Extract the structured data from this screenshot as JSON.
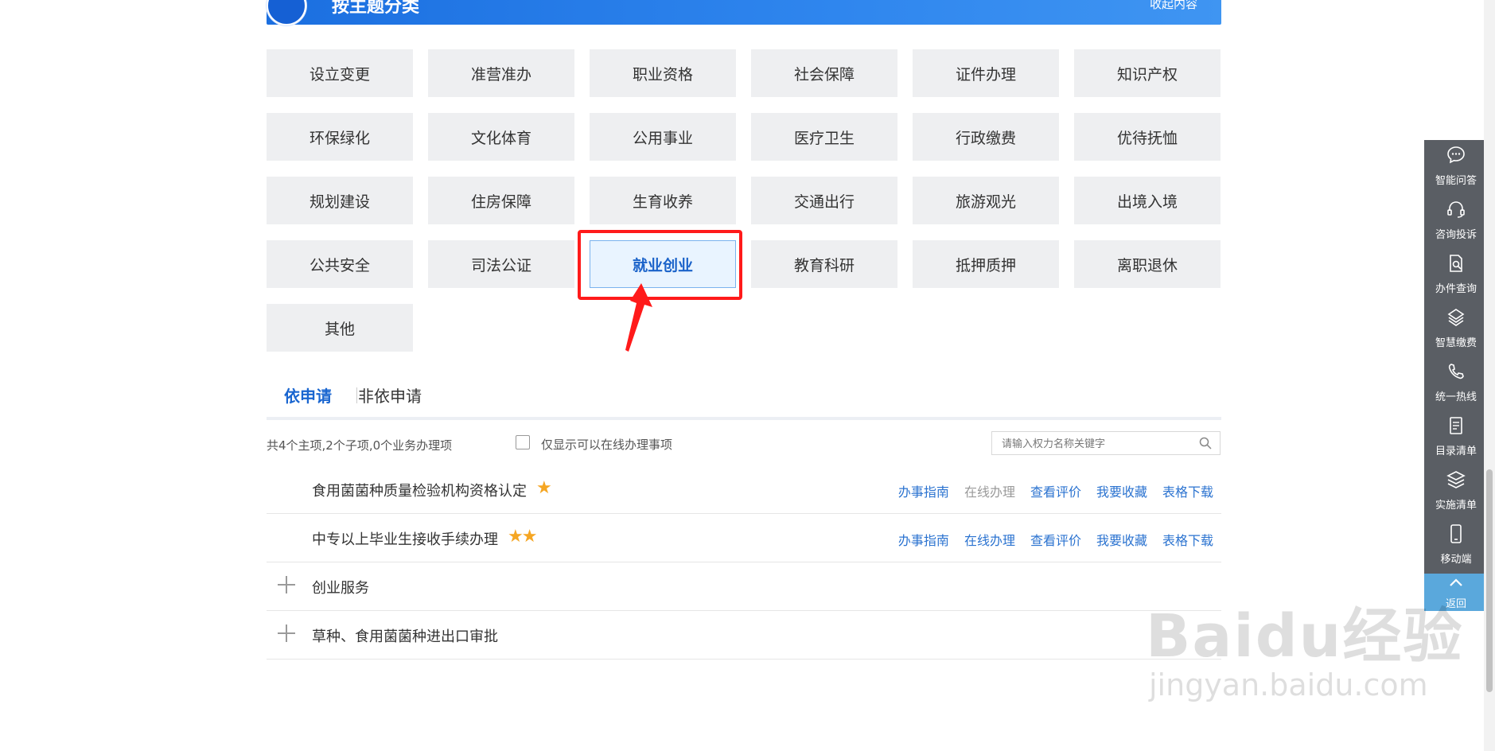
{
  "banner": {
    "title": "按主题分类",
    "collapse": "收起内容"
  },
  "categories": [
    "设立变更",
    "准营准办",
    "职业资格",
    "社会保障",
    "证件办理",
    "知识产权",
    "环保绿化",
    "文化体育",
    "公用事业",
    "医疗卫生",
    "行政缴费",
    "优待抚恤",
    "规划建设",
    "住房保障",
    "生育收养",
    "交通出行",
    "旅游观光",
    "出境入境",
    "公共安全",
    "司法公证",
    "就业创业",
    "教育科研",
    "抵押质押",
    "离职退休",
    "其他"
  ],
  "selected_category": "就业创业",
  "tabs": [
    "依申请",
    "非依申请"
  ],
  "summary": "共4个主项,2个子项,0个业务办理项",
  "online_only_label": "仅显示可以在线办理事项",
  "search": {
    "placeholder": "请输入权力名称关键字"
  },
  "items": [
    {
      "title": "食用菌菌种质量检验机构资格认定",
      "stars": "★",
      "actions": [
        "办事指南",
        "在线办理",
        "查看评价",
        "我要收藏",
        "表格下载"
      ],
      "online_enabled": false
    },
    {
      "title": "中专以上毕业生接收手续办理",
      "stars": "★★",
      "actions": [
        "办事指南",
        "在线办理",
        "查看评价",
        "我要收藏",
        "表格下载"
      ],
      "online_enabled": true
    }
  ],
  "groups": [
    "创业服务",
    "草种、食用菌菌种进出口审批"
  ],
  "sidebar": [
    {
      "label": "智能问答",
      "icon": "chat-bubble-icon"
    },
    {
      "label": "咨询投诉",
      "icon": "headset-icon"
    },
    {
      "label": "办件查询",
      "icon": "document-search-icon"
    },
    {
      "label": "智慧缴费",
      "icon": "payment-icon"
    },
    {
      "label": "统一热线",
      "icon": "phone-icon"
    },
    {
      "label": "目录清单",
      "icon": "list-document-icon"
    },
    {
      "label": "实施清单",
      "icon": "layers-icon"
    },
    {
      "label": "移动端",
      "icon": "mobile-icon"
    }
  ],
  "back_label": "返回",
  "watermark": {
    "main": "Baidu经验",
    "sub": "jingyan.baidu.com"
  },
  "colors": {
    "accent": "#1a66d0",
    "highlight": "#ff1a1a",
    "star": "#f5a623",
    "sidebar": "#5a5e64"
  }
}
